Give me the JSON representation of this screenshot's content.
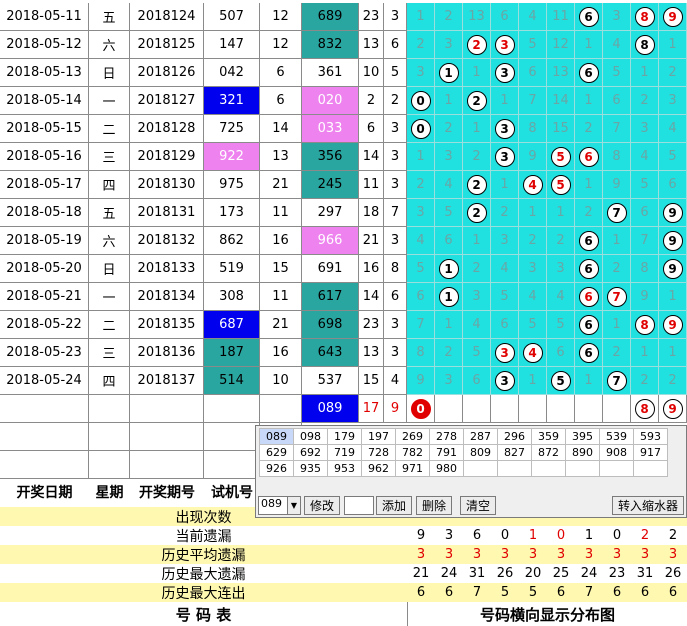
{
  "rows": [
    {
      "date": "2018-05-11",
      "week": "五",
      "issue": "2018124",
      "test": "507",
      "sum1": "12",
      "draw": "689",
      "sum2": "23",
      "span": "3",
      "test_style": "",
      "draw_style": "teal",
      "dist": [
        {
          "n": "1"
        },
        {
          "n": "2"
        },
        {
          "n": "13"
        },
        {
          "n": "6"
        },
        {
          "n": "4"
        },
        {
          "n": "11"
        },
        {
          "n": "6",
          "ball": "black"
        },
        {
          "n": "3"
        },
        {
          "n": "8",
          "ball": "red"
        },
        {
          "n": "9",
          "ball": "red"
        }
      ]
    },
    {
      "date": "2018-05-12",
      "week": "六",
      "issue": "2018125",
      "test": "147",
      "sum1": "12",
      "draw": "832",
      "sum2": "13",
      "span": "6",
      "test_style": "",
      "draw_style": "teal",
      "dist": [
        {
          "n": "2"
        },
        {
          "n": "3"
        },
        {
          "n": "2",
          "ball": "red"
        },
        {
          "n": "3",
          "ball": "red"
        },
        {
          "n": "5"
        },
        {
          "n": "12"
        },
        {
          "n": "1"
        },
        {
          "n": "4"
        },
        {
          "n": "8",
          "ball": "black"
        },
        {
          "n": "1"
        }
      ]
    },
    {
      "date": "2018-05-13",
      "week": "日",
      "issue": "2018126",
      "test": "042",
      "sum1": "6",
      "draw": "361",
      "sum2": "10",
      "span": "5",
      "test_style": "",
      "draw_style": "",
      "dist": [
        {
          "n": "3"
        },
        {
          "n": "1",
          "ball": "black"
        },
        {
          "n": "1"
        },
        {
          "n": "3",
          "ball": "black"
        },
        {
          "n": "6"
        },
        {
          "n": "13"
        },
        {
          "n": "6",
          "ball": "black"
        },
        {
          "n": "5"
        },
        {
          "n": "1"
        },
        {
          "n": "2"
        }
      ]
    },
    {
      "date": "2018-05-14",
      "week": "一",
      "issue": "2018127",
      "test": "321",
      "sum1": "6",
      "draw": "020",
      "sum2": "2",
      "span": "2",
      "test_style": "blue",
      "draw_style": "pink",
      "dist": [
        {
          "n": "0",
          "ball": "black"
        },
        {
          "n": "1"
        },
        {
          "n": "2",
          "ball": "black"
        },
        {
          "n": "1"
        },
        {
          "n": "7"
        },
        {
          "n": "14"
        },
        {
          "n": "1"
        },
        {
          "n": "6"
        },
        {
          "n": "2"
        },
        {
          "n": "3"
        }
      ]
    },
    {
      "date": "2018-05-15",
      "week": "二",
      "issue": "2018128",
      "test": "725",
      "sum1": "14",
      "draw": "033",
      "sum2": "6",
      "span": "3",
      "test_style": "",
      "draw_style": "pink",
      "dist": [
        {
          "n": "0",
          "ball": "black"
        },
        {
          "n": "2"
        },
        {
          "n": "1"
        },
        {
          "n": "3",
          "ball": "black"
        },
        {
          "n": "8"
        },
        {
          "n": "15"
        },
        {
          "n": "2"
        },
        {
          "n": "7"
        },
        {
          "n": "3"
        },
        {
          "n": "4"
        }
      ]
    },
    {
      "date": "2018-05-16",
      "week": "三",
      "issue": "2018129",
      "test": "922",
      "sum1": "13",
      "draw": "356",
      "sum2": "14",
      "span": "3",
      "test_style": "pink",
      "draw_style": "teal",
      "dist": [
        {
          "n": "1"
        },
        {
          "n": "3"
        },
        {
          "n": "2"
        },
        {
          "n": "3",
          "ball": "black"
        },
        {
          "n": "9"
        },
        {
          "n": "5",
          "ball": "red"
        },
        {
          "n": "6",
          "ball": "red"
        },
        {
          "n": "8"
        },
        {
          "n": "4"
        },
        {
          "n": "5"
        }
      ]
    },
    {
      "date": "2018-05-17",
      "week": "四",
      "issue": "2018130",
      "test": "975",
      "sum1": "21",
      "draw": "245",
      "sum2": "11",
      "span": "3",
      "test_style": "",
      "draw_style": "teal",
      "dist": [
        {
          "n": "2"
        },
        {
          "n": "4"
        },
        {
          "n": "2",
          "ball": "black"
        },
        {
          "n": "1"
        },
        {
          "n": "4",
          "ball": "red"
        },
        {
          "n": "5",
          "ball": "red"
        },
        {
          "n": "1"
        },
        {
          "n": "9"
        },
        {
          "n": "5"
        },
        {
          "n": "6"
        }
      ]
    },
    {
      "date": "2018-05-18",
      "week": "五",
      "issue": "2018131",
      "test": "173",
      "sum1": "11",
      "draw": "297",
      "sum2": "18",
      "span": "7",
      "test_style": "",
      "draw_style": "",
      "dist": [
        {
          "n": "3"
        },
        {
          "n": "5"
        },
        {
          "n": "2",
          "ball": "black"
        },
        {
          "n": "2"
        },
        {
          "n": "1"
        },
        {
          "n": "1"
        },
        {
          "n": "2"
        },
        {
          "n": "7",
          "ball": "black"
        },
        {
          "n": "6"
        },
        {
          "n": "9",
          "ball": "black"
        }
      ]
    },
    {
      "date": "2018-05-19",
      "week": "六",
      "issue": "2018132",
      "test": "862",
      "sum1": "16",
      "draw": "966",
      "sum2": "21",
      "span": "3",
      "test_style": "",
      "draw_style": "pink",
      "dist": [
        {
          "n": "4"
        },
        {
          "n": "6"
        },
        {
          "n": "1"
        },
        {
          "n": "3"
        },
        {
          "n": "2"
        },
        {
          "n": "2"
        },
        {
          "n": "6",
          "ball": "black"
        },
        {
          "n": "1"
        },
        {
          "n": "7"
        },
        {
          "n": "9",
          "ball": "black"
        }
      ]
    },
    {
      "date": "2018-05-20",
      "week": "日",
      "issue": "2018133",
      "test": "519",
      "sum1": "15",
      "draw": "691",
      "sum2": "16",
      "span": "8",
      "test_style": "",
      "draw_style": "",
      "dist": [
        {
          "n": "5"
        },
        {
          "n": "1",
          "ball": "black"
        },
        {
          "n": "2"
        },
        {
          "n": "4"
        },
        {
          "n": "3"
        },
        {
          "n": "3"
        },
        {
          "n": "6",
          "ball": "black"
        },
        {
          "n": "2"
        },
        {
          "n": "8"
        },
        {
          "n": "9",
          "ball": "black"
        }
      ]
    },
    {
      "date": "2018-05-21",
      "week": "一",
      "issue": "2018134",
      "test": "308",
      "sum1": "11",
      "draw": "617",
      "sum2": "14",
      "span": "6",
      "test_style": "",
      "draw_style": "teal",
      "dist": [
        {
          "n": "6"
        },
        {
          "n": "1",
          "ball": "black"
        },
        {
          "n": "3"
        },
        {
          "n": "5"
        },
        {
          "n": "4"
        },
        {
          "n": "4"
        },
        {
          "n": "6",
          "ball": "red"
        },
        {
          "n": "7",
          "ball": "red"
        },
        {
          "n": "9"
        },
        {
          "n": "1"
        }
      ]
    },
    {
      "date": "2018-05-22",
      "week": "二",
      "issue": "2018135",
      "test": "687",
      "sum1": "21",
      "draw": "698",
      "sum2": "23",
      "span": "3",
      "test_style": "blue",
      "draw_style": "teal",
      "dist": [
        {
          "n": "7"
        },
        {
          "n": "1"
        },
        {
          "n": "4"
        },
        {
          "n": "6"
        },
        {
          "n": "5"
        },
        {
          "n": "5"
        },
        {
          "n": "6",
          "ball": "black"
        },
        {
          "n": "1"
        },
        {
          "n": "8",
          "ball": "red"
        },
        {
          "n": "9",
          "ball": "red"
        }
      ]
    },
    {
      "date": "2018-05-23",
      "week": "三",
      "issue": "2018136",
      "test": "187",
      "sum1": "16",
      "draw": "643",
      "sum2": "13",
      "span": "3",
      "test_style": "teal",
      "draw_style": "teal",
      "dist": [
        {
          "n": "8"
        },
        {
          "n": "2"
        },
        {
          "n": "5"
        },
        {
          "n": "3",
          "ball": "red"
        },
        {
          "n": "4",
          "ball": "red"
        },
        {
          "n": "6"
        },
        {
          "n": "6",
          "ball": "black"
        },
        {
          "n": "2"
        },
        {
          "n": "1"
        },
        {
          "n": "1"
        }
      ]
    },
    {
      "date": "2018-05-24",
      "week": "四",
      "issue": "2018137",
      "test": "514",
      "sum1": "10",
      "draw": "537",
      "sum2": "15",
      "span": "4",
      "test_style": "teal",
      "draw_style": "",
      "dist": [
        {
          "n": "9"
        },
        {
          "n": "3"
        },
        {
          "n": "6"
        },
        {
          "n": "3",
          "ball": "black"
        },
        {
          "n": "1"
        },
        {
          "n": "5",
          "ball": "black"
        },
        {
          "n": "1"
        },
        {
          "n": "7",
          "ball": "black"
        },
        {
          "n": "2"
        },
        {
          "n": "2"
        }
      ]
    }
  ],
  "forecast": {
    "draw": "089",
    "sum2": "17",
    "span": "9",
    "balls": [
      {
        "col": 0,
        "n": "0",
        "kind": "filled"
      },
      {
        "col": 8,
        "n": "8",
        "kind": "red"
      },
      {
        "col": 9,
        "n": "9",
        "kind": "red"
      }
    ]
  },
  "headers": {
    "date": "开奖日期",
    "week": "星期",
    "issue": "开奖期号",
    "test": "试机号"
  },
  "stats": [
    {
      "label": "出现次数",
      "values": [
        "",
        "",
        "",
        "",
        "",
        "",
        "",
        "",
        "",
        ""
      ]
    },
    {
      "label": "当前遗漏",
      "values": [
        "9",
        "3",
        "6",
        "0",
        "1",
        "0",
        "1",
        "0",
        "2",
        "2"
      ],
      "red": [
        4,
        5,
        8
      ]
    },
    {
      "label": "历史平均遗漏",
      "values": [
        "3",
        "3",
        "3",
        "3",
        "3",
        "3",
        "3",
        "3",
        "3",
        "3"
      ],
      "red": [
        0,
        1,
        2,
        3,
        4,
        5,
        6,
        7,
        8,
        9
      ]
    },
    {
      "label": "历史最大遗漏",
      "values": [
        "21",
        "24",
        "31",
        "26",
        "20",
        "25",
        "24",
        "23",
        "31",
        "26"
      ]
    },
    {
      "label": "历史最大连出",
      "values": [
        "6",
        "6",
        "7",
        "5",
        "5",
        "6",
        "7",
        "6",
        "6",
        "6"
      ]
    }
  ],
  "footer": {
    "left": "号    码    表",
    "right": "号码横向显示分布图"
  },
  "popup": {
    "numbers": [
      [
        "089",
        "098",
        "179",
        "197",
        "269",
        "278",
        "287",
        "296",
        "359",
        "395",
        "539",
        "593"
      ],
      [
        "629",
        "692",
        "719",
        "728",
        "782",
        "791",
        "809",
        "827",
        "872",
        "890",
        "908",
        "917"
      ],
      [
        "926",
        "935",
        "953",
        "962",
        "971",
        "980",
        "",
        "",
        "",
        "",
        "",
        ""
      ]
    ],
    "select_value": "089",
    "btn_modify": "修改",
    "btn_add": "添加",
    "btn_delete": "删除",
    "btn_clear": "清空",
    "btn_shrink": "转入缩水器"
  },
  "colors": {
    "teal": "#2aa6a0",
    "blue": "#0000ee",
    "pink": "#ee82ee",
    "cyan": "#20e0e0",
    "red": "#e00000"
  }
}
